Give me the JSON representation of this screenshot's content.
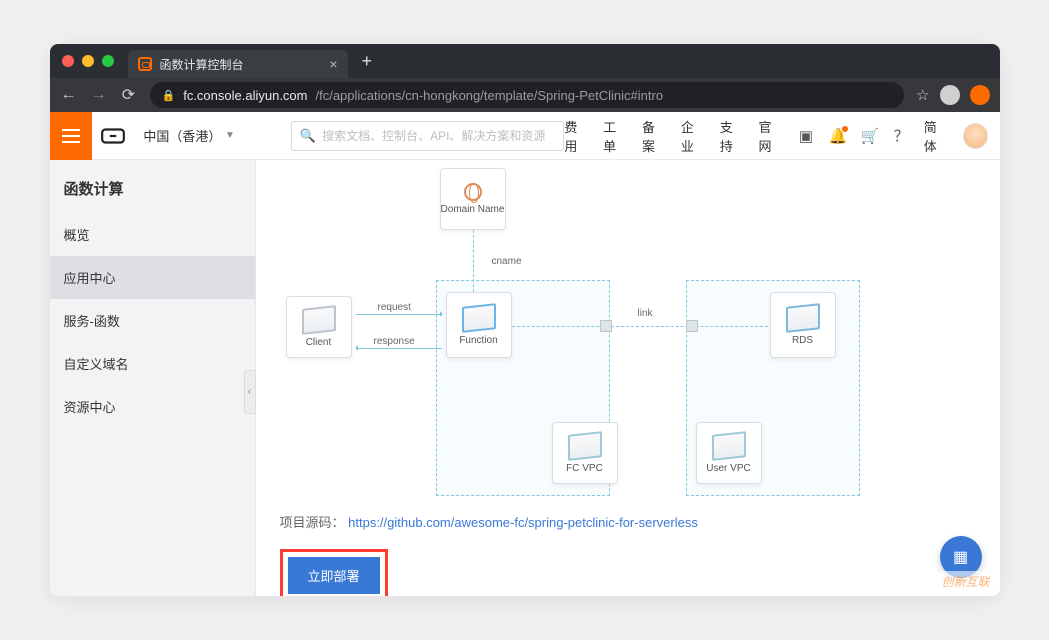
{
  "browser": {
    "tab_title": "函数计算控制台",
    "url_host": "fc.console.aliyun.com",
    "url_path": "/fc/applications/cn-hongkong/template/Spring-PetClinic#intro"
  },
  "header": {
    "region": "中国（香港）",
    "search_placeholder": "搜索文档、控制台、API、解决方案和资源",
    "links": [
      "费用",
      "工单",
      "备案",
      "企业",
      "支持",
      "官网"
    ],
    "lang": "简体"
  },
  "sidebar": {
    "title": "函数计算",
    "items": [
      "概览",
      "应用中心",
      "服务-函数",
      "自定义域名",
      "资源中心"
    ],
    "active_index": 1
  },
  "diagram": {
    "nodes": {
      "domain": "Domain Name",
      "cname": "cname",
      "client": "Client",
      "request": "request",
      "response": "response",
      "function": "Function",
      "link": "link",
      "rds": "RDS",
      "fc_vpc": "FC VPC",
      "user_vpc": "User VPC"
    }
  },
  "source": {
    "label": "项目源码：",
    "url_text": "https://github.com/awesome-fc/spring-petclinic-for-serverless"
  },
  "deploy_button": "立即部署",
  "watermark": "创新互联"
}
